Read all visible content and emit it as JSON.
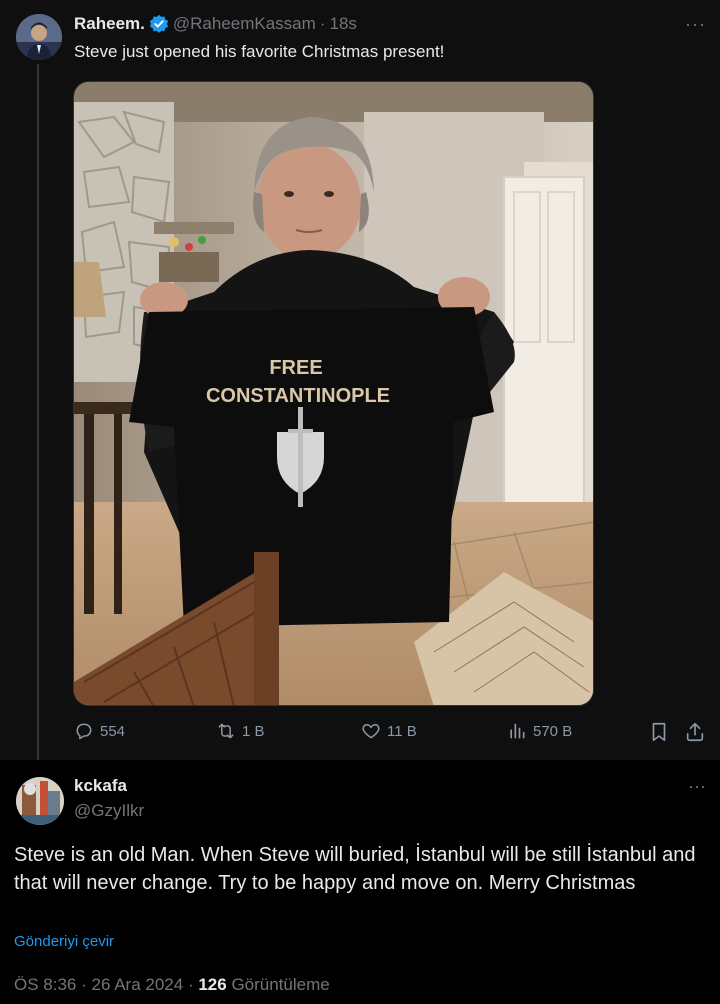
{
  "parent_tweet": {
    "display_name": "Raheem.",
    "handle": "@RaheemKassam",
    "separator": "·",
    "time": "18s",
    "text": "Steve just opened his favorite Christmas present!",
    "shirt_line1": "FREE",
    "shirt_line2": "CONSTANTINOPLE",
    "metrics": {
      "replies": "554",
      "reposts": "1 B",
      "likes": "11 B",
      "views": "570 B"
    }
  },
  "reply": {
    "display_name": "kckafa",
    "handle": "@GzyIlkr",
    "text": "Steve is an old Man. When Steve will buried, İstanbul will be still İstanbul and that will never change. Try to be happy and move on. Merry Christmas",
    "translate_label": "Gönderiyi çevir",
    "time": "ÖS 8:36",
    "date": "26 Ara 2024",
    "views_count": "126",
    "views_label": "Görüntüleme"
  },
  "icons": {
    "reply": "speech-bubble-icon",
    "repost": "repost-arrows-icon",
    "like": "heart-icon",
    "views": "bar-chart-icon",
    "bookmark": "bookmark-icon",
    "share": "share-icon",
    "verified": "verified-badge-icon",
    "more": "more-dots-icon"
  },
  "colors": {
    "background": "#000000",
    "accent": "#1d9bf0",
    "muted": "#71767b",
    "text": "#e7e9ea"
  }
}
